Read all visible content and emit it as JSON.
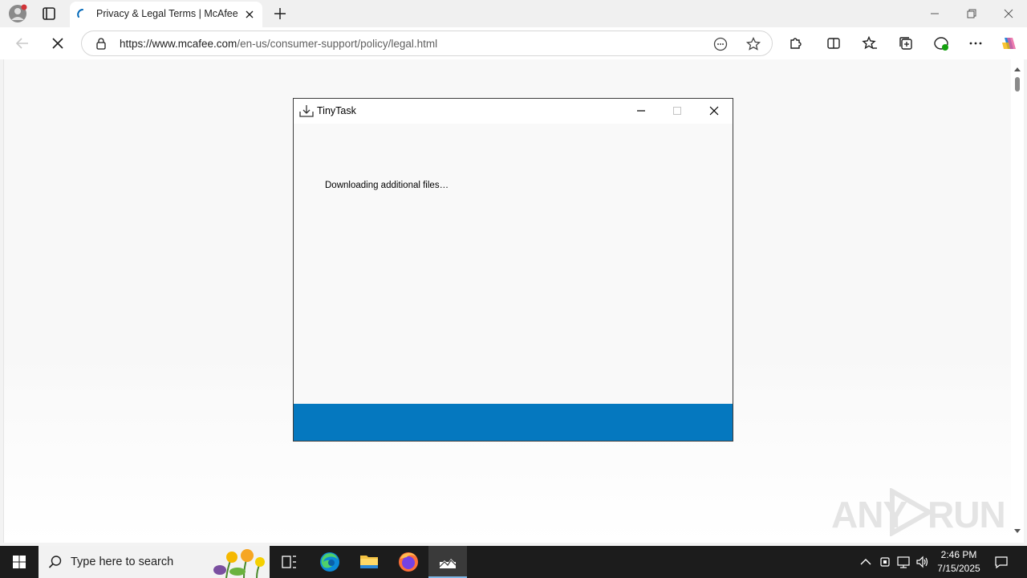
{
  "browser": {
    "tab_title": "Privacy & Legal Terms | McAfee",
    "url_host": "https://www.mcafee.com",
    "url_path": "/en-us/consumer-support/policy/legal.html",
    "accent_color": "#0067b8"
  },
  "dialog": {
    "title": "TinyTask",
    "message": "Downloading additional files…",
    "bar_color": "#0578bf"
  },
  "watermark": {
    "left": "ANY",
    "right": "RUN"
  },
  "taskbar": {
    "search_placeholder": "Type here to search",
    "time": "2:46 PM",
    "date": "7/15/2025"
  }
}
